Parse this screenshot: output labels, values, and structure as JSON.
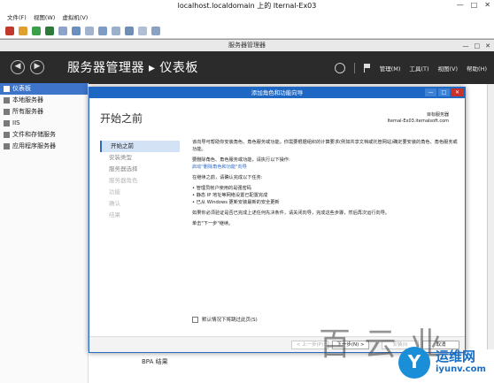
{
  "vm": {
    "title": "localhost.localdomain 上的 Iternal-Ex03",
    "menu": [
      "文件(F)",
      "视图(W)",
      "虚拟机(V)"
    ],
    "win_controls": [
      "—",
      "□",
      "✕"
    ]
  },
  "server_manager": {
    "window_title": "服务器管理器",
    "breadcrumb": "服务器管理器 ▸ 仪表板",
    "nav_back": "◀",
    "nav_forward": "▶",
    "header_menu": [
      "管理(M)",
      "工具(T)",
      "视图(V)",
      "帮助(H)"
    ],
    "sidebar": [
      {
        "label": "仪表板",
        "active": true
      },
      {
        "label": "本地服务器",
        "active": false
      },
      {
        "label": "所有服务器",
        "active": false
      },
      {
        "label": "IIS",
        "active": false
      },
      {
        "label": "文件和存储服务",
        "active": false
      },
      {
        "label": "应用程序服务器",
        "active": false
      }
    ],
    "bpa_label": "BPA 结果"
  },
  "wizard": {
    "title": "添加角色和功能向导",
    "heading": "开始之前",
    "target_label": "目标服务器",
    "target_value": "Iternal-Ex03.iternalsoft.com",
    "steps": [
      {
        "label": "开始之前",
        "state": "current"
      },
      {
        "label": "安装类型",
        "state": "normal"
      },
      {
        "label": "服务器选择",
        "state": "normal"
      },
      {
        "label": "服务器角色",
        "state": "disabled"
      },
      {
        "label": "功能",
        "state": "disabled"
      },
      {
        "label": "确认",
        "state": "disabled"
      },
      {
        "label": "结果",
        "state": "disabled"
      }
    ],
    "body": {
      "p1": "该向导可帮助你安装角色、角色服务或功能。你需要根据组织的计算要求(例如共享文档或托管网站)确定要安装的角色、角色服务或功能。",
      "p2": "要删除角色、角色服务或功能，请执行以下操作:",
      "link": "启动\"删除角色和功能\"向导",
      "p3": "在继续之前，请确认完成以下任务:",
      "bullets": [
        "管理员帐户使用的是强密码",
        "静态 IP 地址等网络设置已配置完成",
        "已从 Windows 更新安装最新的安全更新"
      ],
      "p4": "如果你必须验证是否已完成上述任何先决条件，请关闭向导，完成这些步骤，然后再次运行向导。",
      "p5": "单击\"下一步\"继续。"
    },
    "skip_checkbox": "默认情况下将跳过此页(S)",
    "buttons": {
      "prev": "< 上一步(P)",
      "next": "下一步(N) >",
      "install": "安装(I)",
      "cancel": "取消"
    }
  },
  "watermark": {
    "cn_text": "百 云 业",
    "logo_text": "运维网",
    "logo_domain": "iyunv.com",
    "logo_letter": "Y"
  }
}
